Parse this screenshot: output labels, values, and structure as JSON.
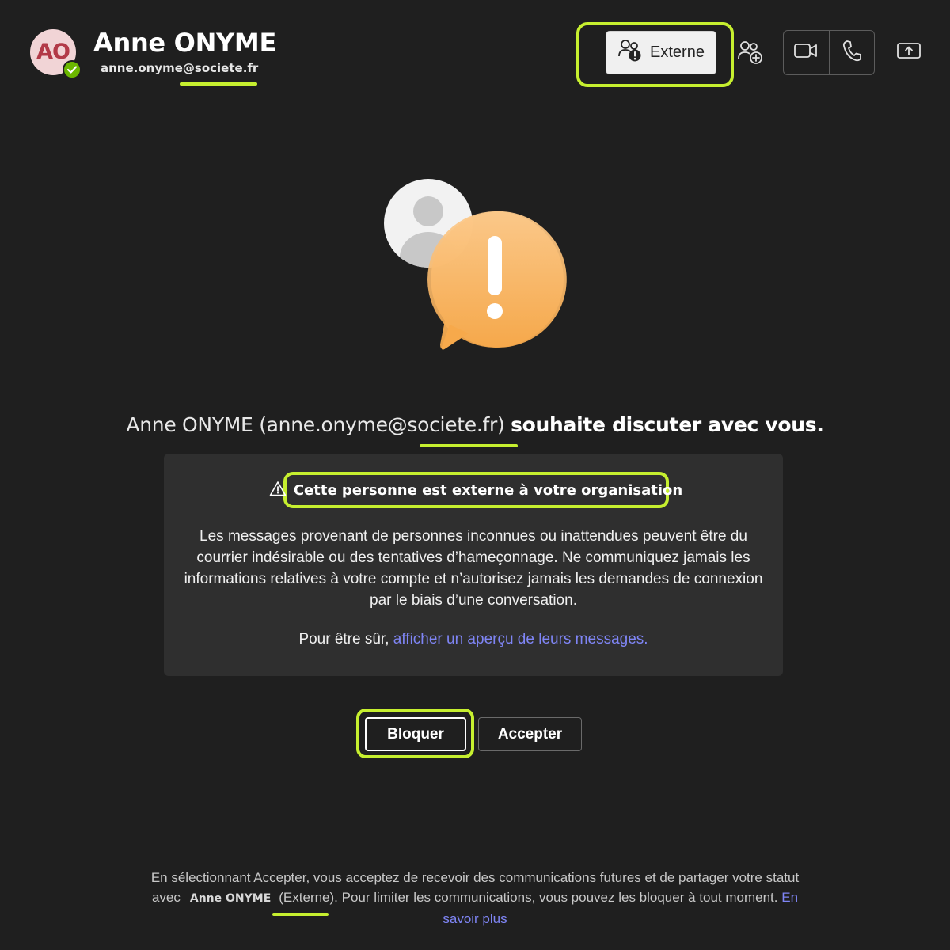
{
  "header": {
    "avatar_initials": "AO",
    "presence": "available",
    "user_name": "Anne ONYME",
    "user_email": "anne.onyme@societe.fr",
    "externe_label": "Externe"
  },
  "icons": {
    "externe_button": "people-warning-icon",
    "add_people": "people-add-icon",
    "video_call": "video-camera-icon",
    "audio_call": "phone-icon",
    "share_screen": "share-screen-icon",
    "card_title": "warning-triangle-icon",
    "illustration": "person-alert-bubble-illustration"
  },
  "message": {
    "heading_who": "Anne ONYME (anne.onyme@societe.fr)",
    "heading_rest": "souhaite discuter avec vous."
  },
  "warning_card": {
    "title": "Cette personne est externe à votre organisation",
    "body_lines": [
      "Les messages provenant de personnes inconnues ou inattendues peuvent être du",
      "courrier indésirable ou des tentatives d’hameçonnage. Ne communiquez jamais les",
      "informations relatives à votre compte et n’autorisez jamais les demandes de connexion",
      "par le biais d’une conversation."
    ],
    "preview_prefix": "Pour être sûr,",
    "preview_link": "afficher un aperçu de leurs messages."
  },
  "actions": {
    "block_label": "Bloquer",
    "accept_label": "Accepter"
  },
  "footer": {
    "line1": "En sélectionnant Accepter, vous acceptez de recevoir des communications futures et de partager votre statut",
    "line2_prefix": "avec",
    "line2_name": "Anne ONYME",
    "line2_suffix": "(Externe). Pour limiter les communications, vous pouvez les bloquer à tout moment.",
    "link_part1": "En",
    "link_part2": "savoir plus"
  },
  "colors": {
    "background": "#1f1f1f",
    "card": "#2f2f2f",
    "highlight": "#c6ef2f",
    "link": "#7f85f5",
    "presence": "#6bb700",
    "alert_bubble": "#f9b25c"
  }
}
